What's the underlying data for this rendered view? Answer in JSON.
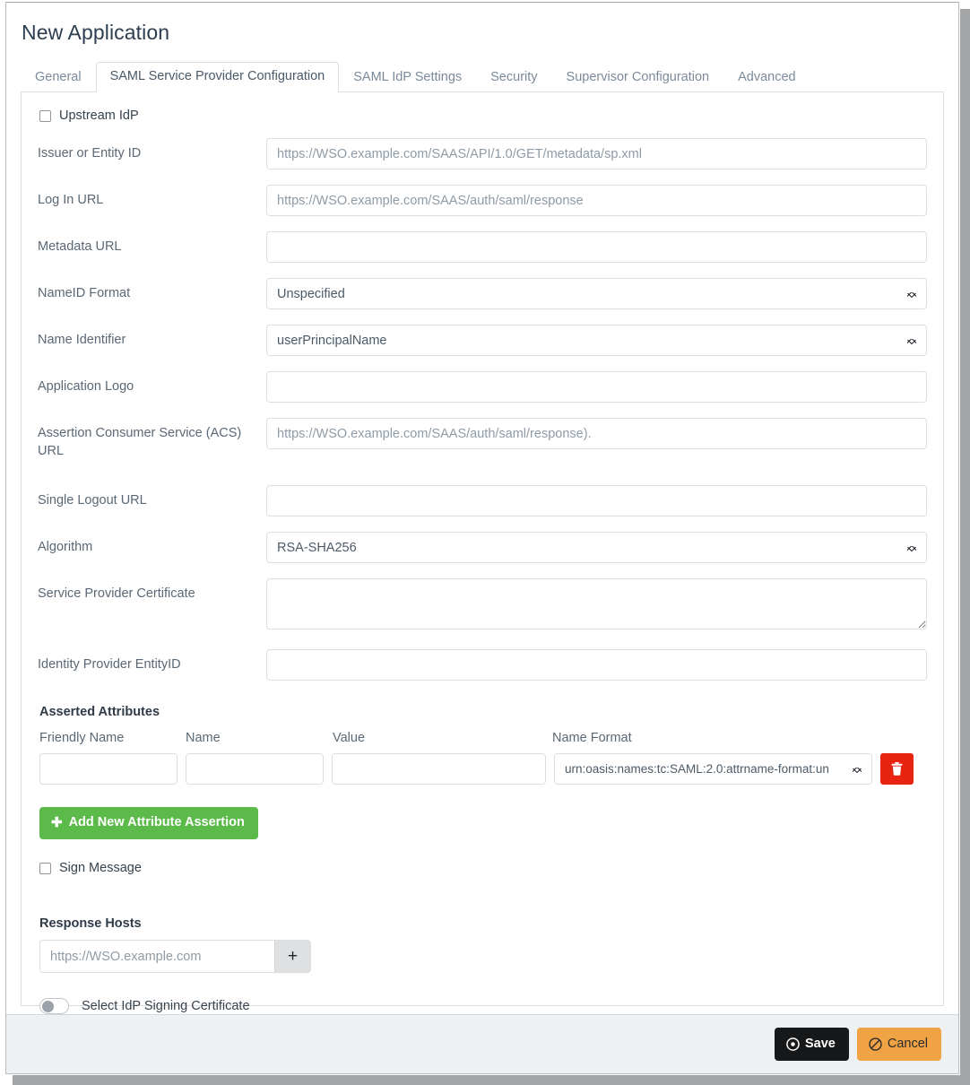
{
  "window": {
    "title": "New Application"
  },
  "tabs": [
    {
      "label": "General",
      "active": false
    },
    {
      "label": "SAML Service Provider Configuration",
      "active": true
    },
    {
      "label": "SAML IdP Settings",
      "active": false
    },
    {
      "label": "Security",
      "active": false
    },
    {
      "label": "Supervisor Configuration",
      "active": false
    },
    {
      "label": "Advanced",
      "active": false
    }
  ],
  "form": {
    "upstream_idp": {
      "label": "Upstream IdP",
      "checked": false
    },
    "fields": {
      "issuer": {
        "label": "Issuer or Entity ID",
        "value": "",
        "placeholder": "https://WSO.example.com/SAAS/API/1.0/GET/metadata/sp.xml"
      },
      "login_url": {
        "label": "Log In URL",
        "value": "",
        "placeholder": "https://WSO.example.com/SAAS/auth/saml/response"
      },
      "metadata_url": {
        "label": "Metadata URL",
        "value": "",
        "placeholder": ""
      },
      "nameid_format": {
        "label": "NameID Format",
        "value": "Unspecified",
        "options": [
          "Unspecified"
        ]
      },
      "name_identifier": {
        "label": "Name Identifier",
        "value": "userPrincipalName",
        "options": [
          "userPrincipalName"
        ]
      },
      "application_logo": {
        "label": "Application Logo",
        "value": "",
        "placeholder": ""
      },
      "acs_url": {
        "label": "Assertion Consumer Service (ACS) URL",
        "value": "",
        "placeholder": "https://WSO.example.com/SAAS/auth/saml/response)."
      },
      "single_logout_url": {
        "label": "Single Logout URL",
        "value": "",
        "placeholder": ""
      },
      "algorithm": {
        "label": "Algorithm",
        "value": "RSA-SHA256",
        "options": [
          "RSA-SHA256"
        ]
      },
      "sp_certificate": {
        "label": "Service Provider Certificate",
        "value": "",
        "placeholder": ""
      },
      "idp_entityid": {
        "label": "Identity Provider EntityID",
        "value": "",
        "placeholder": ""
      }
    },
    "asserted_attributes": {
      "title": "Asserted Attributes",
      "columns": [
        "Friendly Name",
        "Name",
        "Value",
        "Name Format"
      ],
      "rows": [
        {
          "friendly_name": "",
          "name": "",
          "value": "",
          "name_format": "urn:oasis:names:tc:SAML:2.0:attrname-format:un",
          "delete_icon": "trash-icon"
        }
      ],
      "add_button": {
        "label": "Add New Attribute Assertion",
        "icon": "plus-icon"
      }
    },
    "sign_message": {
      "label": "Sign Message",
      "checked": false
    },
    "response_hosts": {
      "title": "Response Hosts",
      "input_value": "",
      "input_placeholder": "https://WSO.example.com",
      "add_icon": "plus-icon"
    },
    "select_idp_signing_certificate": {
      "label": "Select IdP Signing Certificate",
      "enabled": false
    }
  },
  "footer": {
    "save": {
      "label": "Save",
      "icon": "target-icon"
    },
    "cancel": {
      "label": "Cancel",
      "icon": "no-entry-icon"
    }
  },
  "colors": {
    "accent_green": "#5bba49",
    "danger_red": "#e8230f",
    "cancel_orange": "#f0a345",
    "save_dark": "#16181a",
    "footer_bg": "#eef1f4",
    "label_text": "#5a6875",
    "border": "#dddddd"
  }
}
